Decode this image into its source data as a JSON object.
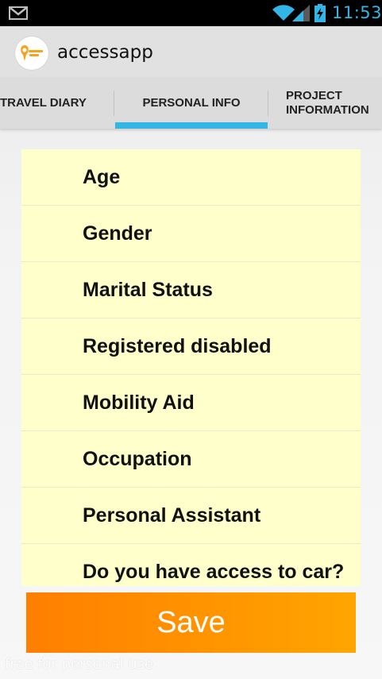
{
  "status_bar": {
    "time": "11:53",
    "icons": [
      "gmail-icon",
      "wifi-icon",
      "signal-icon",
      "battery-charging-icon"
    ]
  },
  "action_bar": {
    "app_title": "accessapp",
    "icon": "accessapp-logo"
  },
  "tabs": [
    {
      "label": "TRAVEL DIARY",
      "selected": false
    },
    {
      "label": "PERSONAL INFO",
      "selected": true
    },
    {
      "label": "PROJECT\nINFORMATION",
      "selected": false
    }
  ],
  "form_items": [
    {
      "label": "Age"
    },
    {
      "label": "Gender"
    },
    {
      "label": "Marital Status"
    },
    {
      "label": "Registered disabled"
    },
    {
      "label": "Mobility Aid"
    },
    {
      "label": "Occupation"
    },
    {
      "label": "Personal Assistant"
    },
    {
      "label": "Do you have access to car?"
    }
  ],
  "save_button": {
    "label": "Save"
  },
  "watermark": "free for personal use",
  "colors": {
    "tab_indicator": "#33b5e5",
    "list_background": "#ffffcc",
    "save_gradient_start": "#ff7f00",
    "save_gradient_end": "#ffa500",
    "clock": "#33b5e5"
  }
}
